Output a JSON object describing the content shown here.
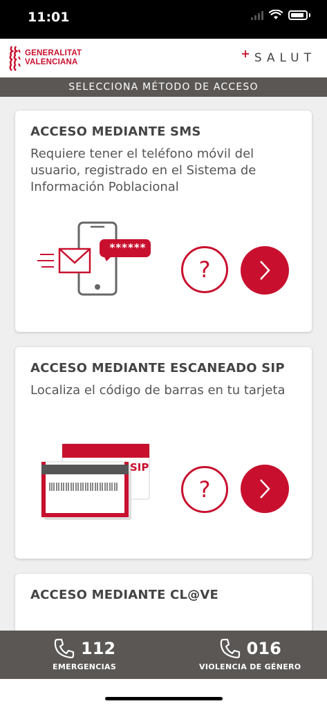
{
  "status_bar": {
    "time": "11:01"
  },
  "header": {
    "gv_line1": "GENERALITAT",
    "gv_line2": "VALENCIANA",
    "salut_cross": "+",
    "salut_text": "SALUT"
  },
  "section_title": "SELECCIONA MÉTODO DE ACCESO",
  "cards": [
    {
      "title": "ACCESO MEDIANTE SMS",
      "description": "Requiere tener el teléfono móvil del usuario, registrado en el Sistema de Información Poblacional",
      "sms_code": "******",
      "help_label": "?"
    },
    {
      "title": "ACCESO MEDIANTE ESCANEADO SIP",
      "description": "Localiza el código de barras en tu tarjeta",
      "sip_label": "SIP",
      "help_label": "?"
    },
    {
      "title": "ACCESO MEDIANTE CL@VE"
    }
  ],
  "emergency": [
    {
      "number": "112",
      "label": "EMERGENCIAS"
    },
    {
      "number": "016",
      "label": "VIOLENCIA DE GÉNERO"
    }
  ],
  "colors": {
    "accent_red": "#c8102e",
    "bar_gray": "#5a5755",
    "background": "#efefef"
  }
}
